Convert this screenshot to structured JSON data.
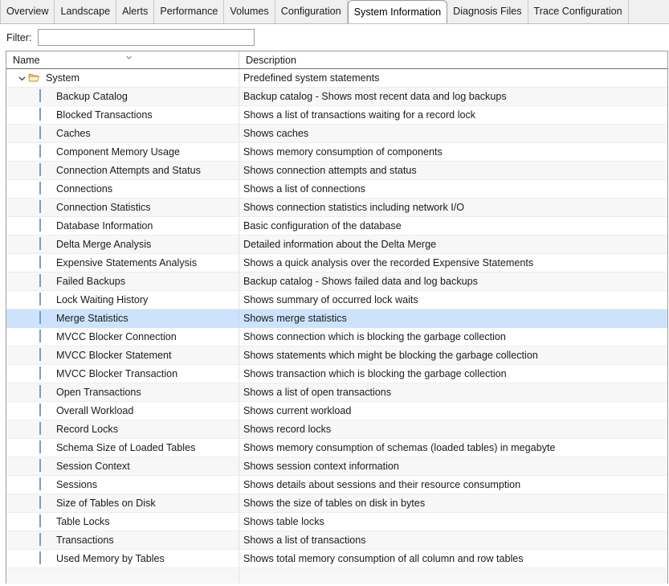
{
  "tabs": [
    {
      "label": "Overview",
      "active": false
    },
    {
      "label": "Landscape",
      "active": false
    },
    {
      "label": "Alerts",
      "active": false
    },
    {
      "label": "Performance",
      "active": false
    },
    {
      "label": "Volumes",
      "active": false
    },
    {
      "label": "Configuration",
      "active": false
    },
    {
      "label": "System Information",
      "active": true
    },
    {
      "label": "Diagnosis Files",
      "active": false
    },
    {
      "label": "Trace Configuration",
      "active": false
    }
  ],
  "filter": {
    "label": "Filter:",
    "value": "",
    "placeholder": ""
  },
  "table": {
    "columns": [
      {
        "key": "name",
        "label": "Name",
        "sort_indicator": "chevron-down"
      },
      {
        "key": "description",
        "label": "Description"
      }
    ],
    "colors": {
      "selection": "#cce3fb",
      "row_alt": "#f7f7f7",
      "border": "#9d9d9d",
      "folder_icon": "#e8a33d",
      "grid_icon_header": "#4a7ebb"
    },
    "rows": [
      {
        "name": "System",
        "description": "Predefined system statements",
        "type": "group",
        "icon": "folder-open-icon",
        "expanded": true,
        "selected": false
      },
      {
        "name": "Backup Catalog",
        "description": "Backup catalog - Shows most recent data and log backups",
        "type": "item",
        "icon": "table-icon",
        "selected": false
      },
      {
        "name": "Blocked Transactions",
        "description": "Shows a list of transactions waiting for a record lock",
        "type": "item",
        "icon": "table-icon",
        "selected": false
      },
      {
        "name": "Caches",
        "description": "Shows caches",
        "type": "item",
        "icon": "table-icon",
        "selected": false
      },
      {
        "name": "Component Memory Usage",
        "description": "Shows memory consumption of components",
        "type": "item",
        "icon": "table-icon",
        "selected": false
      },
      {
        "name": "Connection Attempts and Status",
        "description": "Shows connection attempts and status",
        "type": "item",
        "icon": "table-icon",
        "selected": false
      },
      {
        "name": "Connections",
        "description": "Shows a list of connections",
        "type": "item",
        "icon": "table-icon",
        "selected": false
      },
      {
        "name": "Connection Statistics",
        "description": "Shows connection statistics including network I/O",
        "type": "item",
        "icon": "table-icon",
        "selected": false
      },
      {
        "name": "Database Information",
        "description": "Basic configuration of the database",
        "type": "item",
        "icon": "table-icon",
        "selected": false
      },
      {
        "name": "Delta Merge Analysis",
        "description": "Detailed information about the Delta Merge",
        "type": "item",
        "icon": "table-icon",
        "selected": false
      },
      {
        "name": "Expensive Statements Analysis",
        "description": "Shows a quick analysis over the recorded Expensive Statements",
        "type": "item",
        "icon": "table-icon",
        "selected": false
      },
      {
        "name": "Failed Backups",
        "description": "Backup catalog - Shows failed data and log backups",
        "type": "item",
        "icon": "table-icon",
        "selected": false
      },
      {
        "name": "Lock Waiting History",
        "description": "Shows summary of occurred lock waits",
        "type": "item",
        "icon": "table-icon",
        "selected": false
      },
      {
        "name": "Merge Statistics",
        "description": "Shows merge statistics",
        "type": "item",
        "icon": "table-icon",
        "selected": true
      },
      {
        "name": "MVCC Blocker Connection",
        "description": "Shows connection which is blocking the garbage collection",
        "type": "item",
        "icon": "table-icon",
        "selected": false
      },
      {
        "name": "MVCC Blocker Statement",
        "description": "Shows statements which might be blocking the garbage collection",
        "type": "item",
        "icon": "table-icon",
        "selected": false
      },
      {
        "name": "MVCC Blocker Transaction",
        "description": "Shows transaction which is blocking the garbage collection",
        "type": "item",
        "icon": "table-icon",
        "selected": false
      },
      {
        "name": "Open Transactions",
        "description": "Shows a list of open transactions",
        "type": "item",
        "icon": "table-icon",
        "selected": false
      },
      {
        "name": "Overall Workload",
        "description": "Shows current workload",
        "type": "item",
        "icon": "table-icon",
        "selected": false
      },
      {
        "name": "Record Locks",
        "description": "Shows record locks",
        "type": "item",
        "icon": "table-icon",
        "selected": false
      },
      {
        "name": "Schema Size of Loaded Tables",
        "description": "Shows memory consumption of schemas (loaded tables) in megabyte",
        "type": "item",
        "icon": "table-icon",
        "selected": false
      },
      {
        "name": "Session Context",
        "description": "Shows session context information",
        "type": "item",
        "icon": "table-icon",
        "selected": false
      },
      {
        "name": "Sessions",
        "description": "Shows details about sessions and their resource consumption",
        "type": "item",
        "icon": "table-icon",
        "selected": false
      },
      {
        "name": "Size of Tables on Disk",
        "description": "Shows the size of tables on disk in bytes",
        "type": "item",
        "icon": "table-icon",
        "selected": false
      },
      {
        "name": "Table Locks",
        "description": "Shows table locks",
        "type": "item",
        "icon": "table-icon",
        "selected": false
      },
      {
        "name": "Transactions",
        "description": "Shows a list of transactions",
        "type": "item",
        "icon": "table-icon",
        "selected": false
      },
      {
        "name": "Used Memory by Tables",
        "description": "Shows total memory consumption of all column and row tables",
        "type": "item",
        "icon": "table-icon",
        "selected": false
      },
      {
        "name": "",
        "description": "",
        "type": "item",
        "icon": "none",
        "selected": false
      }
    ]
  }
}
